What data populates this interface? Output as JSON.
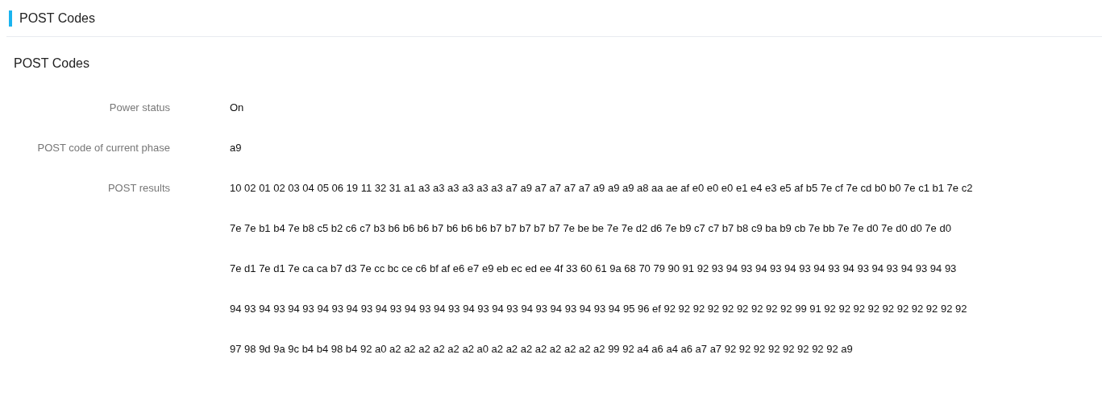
{
  "header": {
    "title": "POST Codes"
  },
  "section": {
    "title": "POST Codes",
    "fields": [
      {
        "label": "Power status",
        "value": "On"
      },
      {
        "label": "POST code of current phase",
        "value": "a9"
      }
    ],
    "results": {
      "label": "POST results",
      "lines": [
        "10 02 01 02 03 04 05 06 19 11 32 31 a1 a3 a3 a3 a3 a3 a3 a7 a9 a7 a7 a7 a7 a9 a9 a9 a8 aa ae af e0 e0 e0 e1 e4 e3 e5 af b5 7e cf 7e cd b0 b0 7e c1 b1 7e c2",
        "7e 7e b1 b4 7e b8 c5 b2 c6 c7 b3 b6 b6 b6 b7 b6 b6 b6 b7 b7 b7 b7 b7 7e be be 7e 7e d2 d6 7e b9 c7 c7 b7 b8 c9 ba b9 cb 7e bb 7e 7e d0 7e d0 d0 7e d0",
        "7e d1 7e d1 7e ca ca b7 d3 7e cc bc ce c6 bf af e6 e7 e9 eb ec ed ee 4f 33 60 61 9a 68 70 79 90 91 92 93 94 93 94 93 94 93 94 93 94 93 94 93 94 93 94 93",
        "94 93 94 93 94 93 94 93 94 93 94 93 94 93 94 93 94 93 94 93 94 93 94 93 94 93 94 95 96 ef 92 92 92 92 92 92 92 92 92 99 91 92 92 92 92 92 92 92 92 92 92",
        "97 98 9d 9a 9c b4 b4 98 b4 92 a0 a2 a2 a2 a2 a2 a2 a0 a2 a2 a2 a2 a2 a2 a2 a2 99 92 a4 a6 a4 a6 a7 a7 92 92 92 92 92 92 92 92 a9"
      ]
    }
  }
}
